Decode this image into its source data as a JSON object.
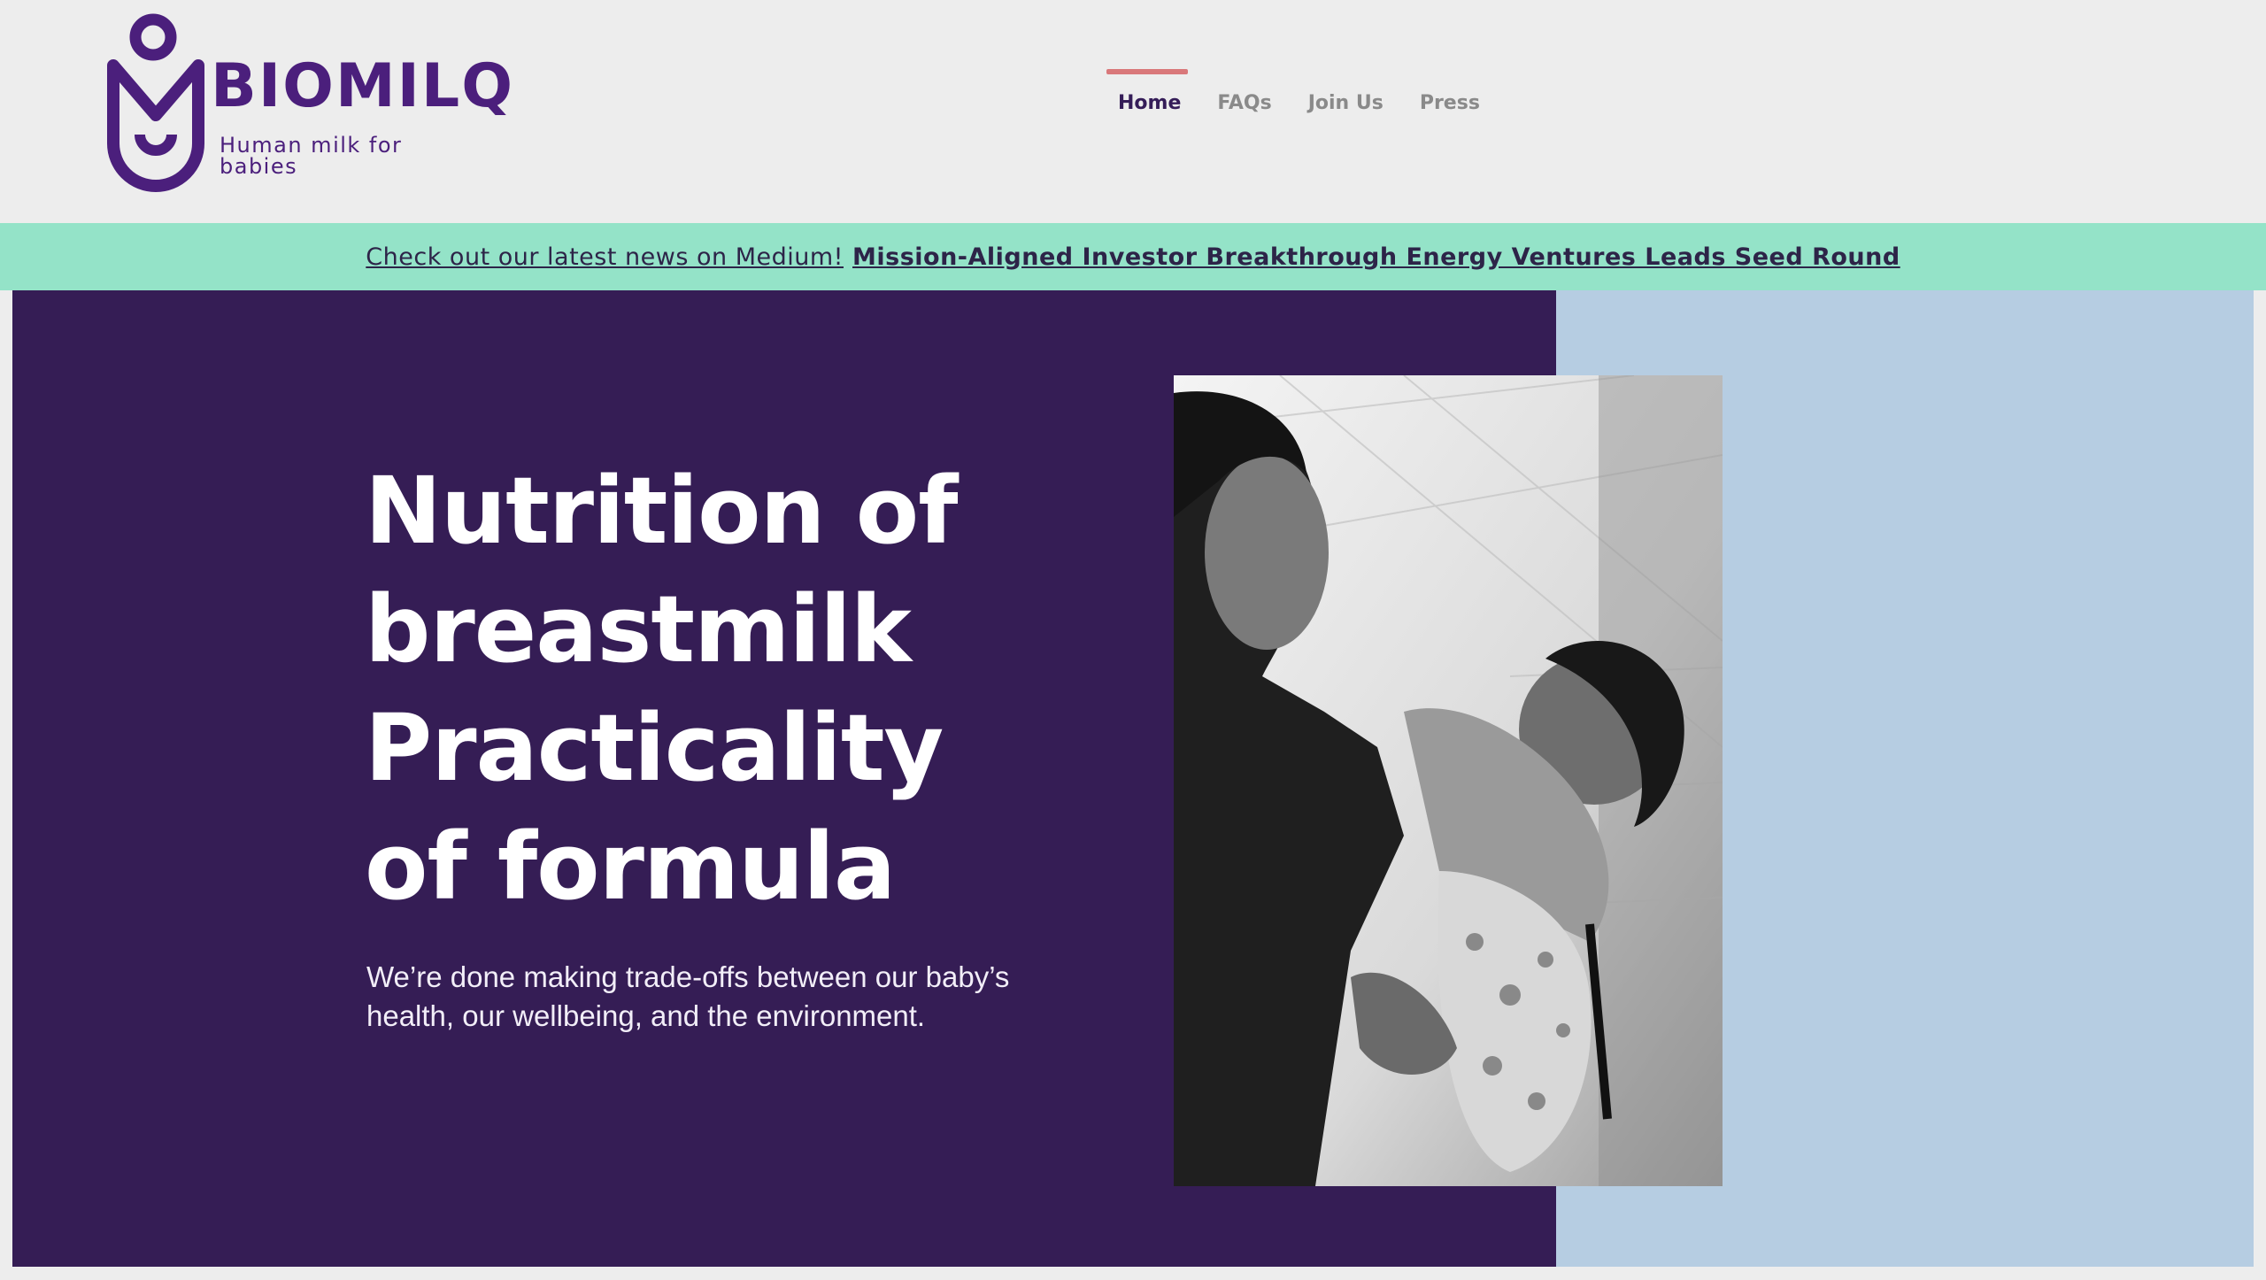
{
  "brand": {
    "name": "BIOMILQ",
    "tagline": "Human milk for babies",
    "color": "#4b1f7c"
  },
  "nav": {
    "items": [
      {
        "label": "Home",
        "active": true
      },
      {
        "label": "FAQs",
        "active": false
      },
      {
        "label": "Join Us",
        "active": false
      },
      {
        "label": "Press",
        "active": false
      }
    ],
    "active_indicator_color": "#d9787a"
  },
  "banner": {
    "lead": "Check out our latest news on Medium!",
    "headline": "Mission-Aligned Investor Breakthrough Energy Ventures Leads Seed Round",
    "background": "#94e3c8"
  },
  "hero": {
    "title_lines": [
      "Nutrition of",
      "breastmilk",
      "Practicality",
      "of formula"
    ],
    "subtitle": "We’re done making trade-offs between our baby’s health, our wellbeing, and the environment.",
    "left_background": "#351d55",
    "right_background": "#b6cde2"
  }
}
